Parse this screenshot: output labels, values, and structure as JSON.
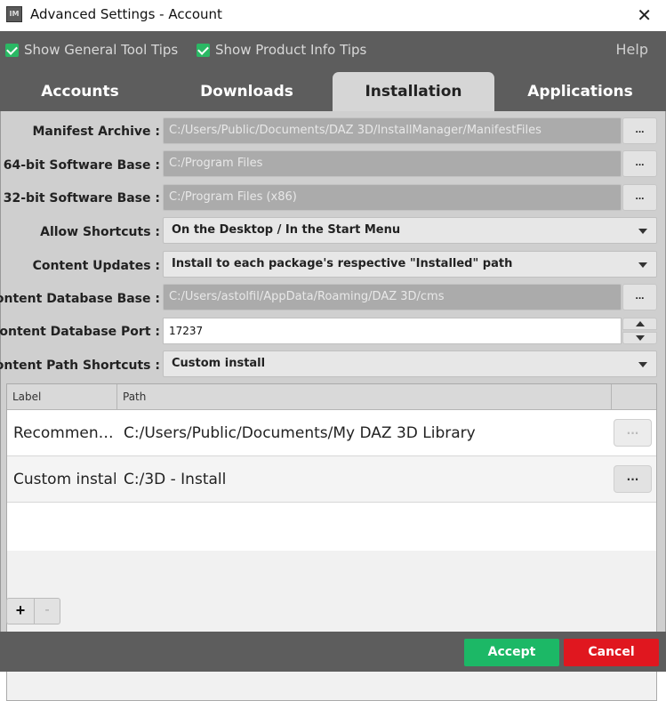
{
  "window": {
    "title": "Advanced Settings - Account",
    "icon_text": "IM"
  },
  "tips": {
    "general": "Show General Tool Tips",
    "product": "Show Product Info Tips",
    "help": "Help"
  },
  "tabs": [
    {
      "label": "Accounts"
    },
    {
      "label": "Downloads"
    },
    {
      "label": "Installation",
      "active": true
    },
    {
      "label": "Applications"
    }
  ],
  "form": {
    "manifest_archive": {
      "label": "Manifest Archive :",
      "value": "C:/Users/Public/Documents/DAZ 3D/InstallManager/ManifestFiles"
    },
    "software_64": {
      "label": "64-bit Software Base :",
      "value": "C:/Program Files"
    },
    "software_32": {
      "label": "32-bit Software Base :",
      "value": "C:/Program Files (x86)"
    },
    "allow_shortcuts": {
      "label": "Allow Shortcuts :",
      "value": "On the Desktop / In the Start Menu"
    },
    "content_updates": {
      "label": "Content Updates :",
      "value": "Install to each package's respective \"Installed\" path"
    },
    "content_db_base": {
      "label": "Content Database Base :",
      "value": "C:/Users/astolfil/AppData/Roaming/DAZ 3D/cms"
    },
    "content_db_port": {
      "label": "Content Database Port :",
      "value": "17237"
    },
    "content_path_shortcuts": {
      "label": "Content Path Shortcuts :",
      "value": "Custom install"
    },
    "browse_label": "..."
  },
  "table": {
    "headers": [
      "Label",
      "Path"
    ],
    "rows": [
      {
        "label": "Recommen…",
        "path": "C:/Users/Public/Documents/My DAZ 3D Library"
      },
      {
        "label": "Custom install",
        "path": "C:/3D - Install"
      }
    ]
  },
  "controls": {
    "plus": "+",
    "minus": "-"
  },
  "buttons": {
    "accept": "Accept",
    "cancel": "Cancel"
  },
  "colors": {
    "accent_green": "#1cb866",
    "cancel_red": "#e0171f",
    "bar": "#5d5d5d"
  }
}
